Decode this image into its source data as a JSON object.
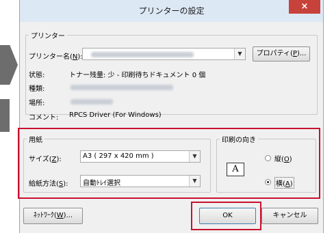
{
  "window": {
    "title": "プリンターの設定",
    "close_glyph": "×"
  },
  "printer": {
    "legend": "プリンター",
    "name_label": "プリンター名(",
    "name_key": "N",
    "name_label_end": "):",
    "properties_label": "プロパティ(",
    "properties_key": "P",
    "properties_label_end": ")...",
    "status_label": "状態:",
    "status_value": "トナー残量: 少 - 印刷待ちドキュメント 0 個",
    "type_label": "種類:",
    "location_label": "場所:",
    "comment_label": "コメント:",
    "comment_value": "RPCS Driver (For Windows)"
  },
  "paper": {
    "legend": "用紙",
    "size_label": "サイズ(",
    "size_key": "Z",
    "size_label_end": "):",
    "size_value": "A3 ( 297 x 420 mm )",
    "source_label": "給紙方法(",
    "source_key": "S",
    "source_label_end": "):",
    "source_value": "自動ﾄﾚｲ選択"
  },
  "orientation": {
    "legend": "印刷の向き",
    "icon_letter": "A",
    "portrait_label": "縦(",
    "portrait_key": "O",
    "portrait_end": ")",
    "landscape_label": "横(",
    "landscape_key": "A",
    "landscape_end": ")",
    "selected": "landscape"
  },
  "buttons": {
    "network_label": "ﾈｯﾄﾜｰｸ(",
    "network_key": "W",
    "network_end": ")...",
    "ok": "OK",
    "cancel": "キャンセル"
  },
  "icons": {
    "dropdown": "▼"
  },
  "colors": {
    "highlight": "#c8102e",
    "close": "#c7423a",
    "titlebar": "#dde8f5"
  }
}
